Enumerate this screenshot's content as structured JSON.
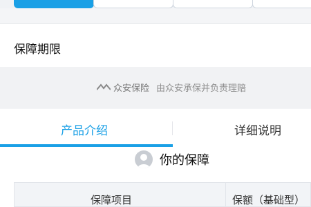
{
  "sections": {
    "period_label": "保障期限",
    "insurer_brand": "众安保险",
    "insurer_text": "由众安承保并负责理赔"
  },
  "tabs": [
    {
      "label": "产品介绍",
      "active": true
    },
    {
      "label": "详细说明",
      "active": false
    }
  ],
  "coverage": {
    "title": "你的保障",
    "table_headers": [
      "保障项目",
      "保额（基础型）"
    ]
  },
  "colors": {
    "accent": "#1aa0e6"
  },
  "icons": {
    "avatar": "user-avatar-icon",
    "insurer_logo": "zhongan-logo-icon"
  }
}
